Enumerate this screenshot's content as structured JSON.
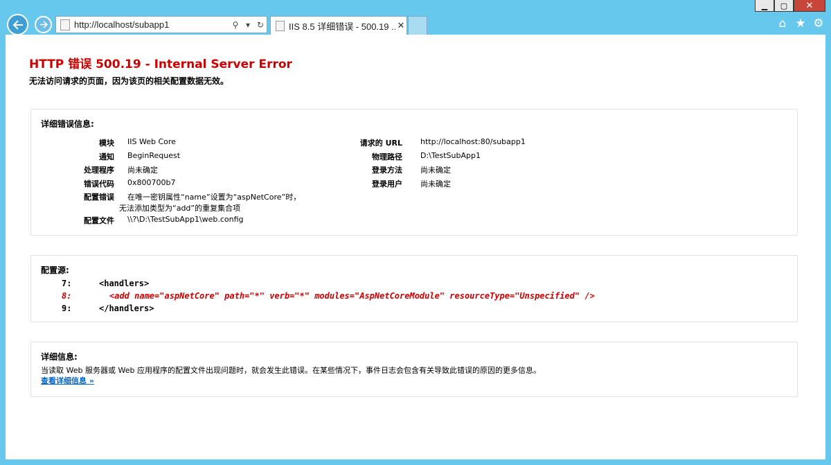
{
  "window": {
    "minimize": "▁",
    "maximize": "▢",
    "close": "✕"
  },
  "nav": {
    "back_icon": "arrow-left",
    "forward_icon": "arrow-right"
  },
  "address": {
    "url": "http://localhost/subapp1",
    "search_icon": "⚲",
    "dropdown": "▾",
    "refresh": "↻"
  },
  "tab": {
    "title": "IIS 8.5 详细错误 - 500.19 ...",
    "close": "✕"
  },
  "toolbar": {
    "home": "⌂",
    "favorites": "★",
    "settings": "⚙"
  },
  "error": {
    "title": "HTTP 错误 500.19 - Internal Server Error",
    "subtitle": "无法访问请求的页面，因为该页的相关配置数据无效。"
  },
  "details": {
    "title": "详细错误信息:",
    "left": [
      {
        "key": "模块",
        "value": "IIS Web Core"
      },
      {
        "key": "通知",
        "value": "BeginRequest"
      },
      {
        "key": "处理程序",
        "value": "尚未确定"
      },
      {
        "key": "错误代码",
        "value": "0x800700b7"
      },
      {
        "key": "配置错误",
        "value": "在唯一密钥属性“name”设置为“aspNetCore”时，",
        "value2": "无法添加类型为“add”的重复集合项"
      },
      {
        "key": "配置文件",
        "value": "\\\\?\\D:\\TestSubApp1\\web.config"
      }
    ],
    "right": [
      {
        "key": "请求的 URL",
        "value": "http://localhost:80/subapp1"
      },
      {
        "key": "物理路径",
        "value": "D:\\TestSubApp1"
      },
      {
        "key": "登录方法",
        "value": "尚未确定"
      },
      {
        "key": "登录用户",
        "value": "尚未确定"
      }
    ]
  },
  "config_source": {
    "title": "配置源:",
    "lines": [
      {
        "num": "7:",
        "text": "<handlers>"
      },
      {
        "num": "8:",
        "text": "<add name=\"aspNetCore\" path=\"*\" verb=\"*\" modules=\"AspNetCoreModule\" resourceType=\"Unspecified\" />"
      },
      {
        "num": "9:",
        "text": "</handlers>"
      }
    ]
  },
  "more_info": {
    "title": "详细信息:",
    "text": "当读取 Web 服务器或 Web 应用程序的配置文件出现问题时，就会发生此错误。在某些情况下，事件日志会包含有关导致此错误的原因的更多信息。",
    "link": "查看详细信息 »"
  },
  "colors": {
    "frame": "#65c8ec",
    "error_red": "#cc0000",
    "link": "#0066cc"
  }
}
